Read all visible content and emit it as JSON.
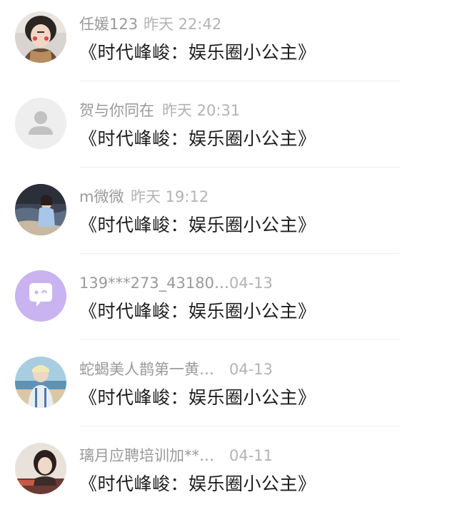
{
  "comments": [
    {
      "username": "任媛123",
      "time": "昨天 22:42",
      "content": "《时代峰峻：娱乐圈小公主》",
      "avatar": "photo-girl-red-cheeks-icon"
    },
    {
      "username": "贺与你同在",
      "time": "昨天 20:31",
      "content": "《时代峰峻：娱乐圈小公主》",
      "avatar": "default-user-icon"
    },
    {
      "username": "m微微",
      "time": "昨天 19:12",
      "content": "《时代峰峻：娱乐圈小公主》",
      "avatar": "photo-beach-figure-icon"
    },
    {
      "username": "139***273_43180…",
      "time": "04-13",
      "content": "《时代峰峻：娱乐圈小公主》",
      "avatar": "purple-chat-bubble-icon"
    },
    {
      "username": "蛇蝎美人鹊第一黄…",
      "time": "04-13",
      "content": "《时代峰峻：娱乐圈小公主》",
      "avatar": "photo-blond-boy-icon"
    },
    {
      "username": "璃月应聘培训加**…",
      "time": "04-11",
      "content": "《时代峰峻：娱乐圈小公主》",
      "avatar": "photo-girl-portrait-icon"
    }
  ],
  "colors": {
    "username": "#9a9a9a",
    "time": "#b3b3b3",
    "content": "#1e1e1e",
    "divider": "#eeeeee",
    "purple_avatar": "#c9b3f0"
  }
}
